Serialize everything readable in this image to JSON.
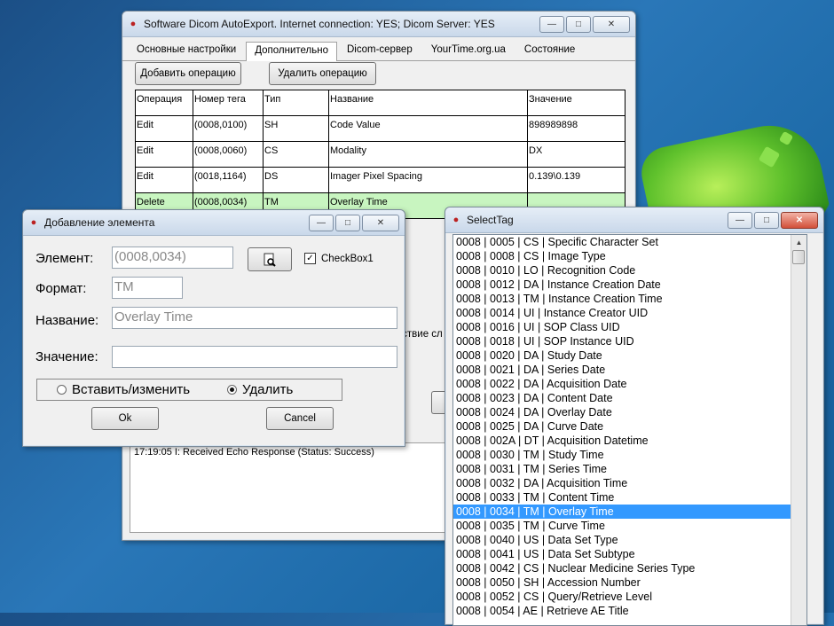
{
  "main_window": {
    "title": "Software Dicom AutoExport. Internet connection: YES; Dicom Server: YES",
    "tabs": [
      "Основные настройки",
      "Дополнительно",
      "Dicom-сервер",
      "YourTime.org.ua",
      "Состояние"
    ],
    "active_tab": 1,
    "add_op_label": "Добавить операцию",
    "del_op_label": "Удалить операцию",
    "columns": [
      "Операция",
      "Номер тега",
      "Тип",
      "Название",
      "Значение"
    ],
    "rows": [
      [
        "Edit",
        "(0008,0100)",
        "SH",
        "Code Value",
        "898989898"
      ],
      [
        "Edit",
        "(0008,0060)",
        "CS",
        "Modality",
        "DX"
      ],
      [
        "Edit",
        "(0018,1164)",
        "DS",
        "Imager Pixel Spacing",
        "0.139\\0.139"
      ],
      [
        "Delete",
        "(0008,0034)",
        "TM",
        "Overlay Time",
        ""
      ]
    ],
    "partial_text": "тствие сл",
    "log_line": "17:19:05 I: Received Echo Response (Status: Success)"
  },
  "add_dialog": {
    "title": "Добавление элемента",
    "element_label": "Элемент:",
    "element_value": "(0008,0034)",
    "format_label": "Формат:",
    "format_value": "TM",
    "name_label": "Название:",
    "name_value": "Overlay Time",
    "value_label": "Значение:",
    "value_value": "",
    "checkbox_label": "CheckBox1",
    "radio_insert": "Вставить/изменить",
    "radio_delete": "Удалить",
    "ok_label": "Ok",
    "cancel_label": "Cancel"
  },
  "select_tag": {
    "title": "SelectTag",
    "selected_index": 19,
    "items": [
      "0008 | 0005 | CS | Specific Character Set",
      "0008 | 0008 | CS | Image Type",
      "0008 | 0010 | LO | Recognition Code",
      "0008 | 0012 | DA | Instance Creation Date",
      "0008 | 0013 | TM | Instance Creation Time",
      "0008 | 0014 | UI | Instance Creator UID",
      "0008 | 0016 | UI | SOP Class UID",
      "0008 | 0018 | UI | SOP Instance UID",
      "0008 | 0020 | DA | Study Date",
      "0008 | 0021 | DA | Series Date",
      "0008 | 0022 | DA | Acquisition Date",
      "0008 | 0023 | DA | Content Date",
      "0008 | 0024 | DA | Overlay Date",
      "0008 | 0025 | DA | Curve Date",
      "0008 | 002A | DT | Acquisition Datetime",
      "0008 | 0030 | TM | Study Time",
      "0008 | 0031 | TM | Series Time",
      "0008 | 0032 | DA | Acquisition Time",
      "0008 | 0033 | TM | Content Time",
      "0008 | 0034 | TM | Overlay Time",
      "0008 | 0035 | TM | Curve Time",
      "0008 | 0040 | US | Data Set Type",
      "0008 | 0041 | US | Data Set Subtype",
      "0008 | 0042 | CS | Nuclear Medicine Series Type",
      "0008 | 0050 | SH | Accession Number",
      "0008 | 0052 | CS | Query/Retrieve Level",
      "0008 | 0054 | AE | Retrieve AE Title"
    ]
  }
}
